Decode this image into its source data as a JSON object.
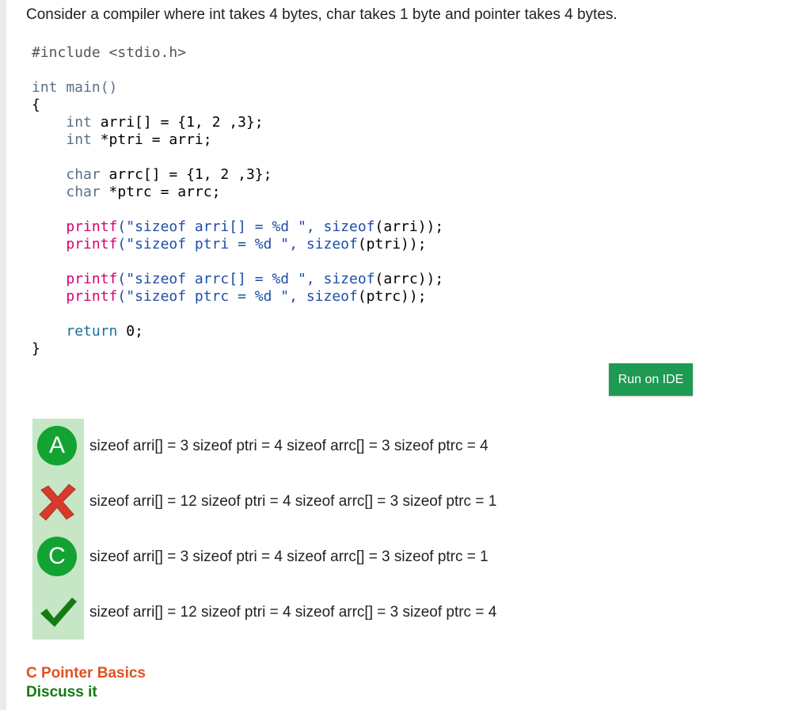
{
  "question": "Consider a compiler where int takes 4 bytes, char takes 1 byte and pointer takes 4 bytes.",
  "code": {
    "include": "#include <stdio.h>",
    "main_sig": "int main()",
    "open_brace": "{",
    "int_kw": "int",
    "arri_decl": " arri[] = {1, 2 ,3};",
    "ptri_decl": " *ptri = arri;",
    "char_kw": "char",
    "arrc_decl": " arrc[] = {1, 2 ,3};",
    "ptrc_decl": " *ptrc = arrc;",
    "printf_kw": "printf",
    "sizeof_kw": "sizeof",
    "fmt1": "(\"sizeof arri[] = %d \",",
    "fmt2": "(\"sizeof ptri = %d \",",
    "fmt3": "(\"sizeof arrc[] = %d \",",
    "fmt4": "(\"sizeof ptrc = %d \",",
    "arg1": "(arri));",
    "arg2": "(ptri));",
    "arg3": "(arrc));",
    "arg4": "(ptrc));",
    "return_kw": "return",
    "return_val": " 0;",
    "close_brace": "}"
  },
  "run_button": {
    "label": "Run on IDE"
  },
  "options": [
    {
      "marker": "A",
      "marker_type": "letter",
      "text": "sizeof arri[] = 3 sizeof ptri = 4 sizeof arrc[] = 3 sizeof ptrc = 4"
    },
    {
      "marker": "wrong",
      "marker_type": "cross-icon",
      "text": "sizeof arri[] = 12 sizeof ptri = 4 sizeof arrc[] = 3 sizeof ptrc = 1"
    },
    {
      "marker": "C",
      "marker_type": "letter",
      "text": "sizeof arri[] = 3 sizeof ptri = 4 sizeof arrc[] = 3 sizeof ptrc = 1"
    },
    {
      "marker": "correct",
      "marker_type": "check-icon",
      "text": "sizeof arri[] = 12 sizeof ptri = 4 sizeof arrc[] = 3 sizeof ptrc = 4"
    }
  ],
  "links": {
    "topic": "C Pointer Basics",
    "discuss": "Discuss it"
  },
  "colors": {
    "option_column_bg": "#c6e6c6",
    "option_circle": "#12a332",
    "wrong_cross": "#d83a2c",
    "correct_check": "#147a14",
    "run_button": "#1e9a52",
    "topic_link": "#e0521f",
    "discuss_link": "#127a12"
  }
}
